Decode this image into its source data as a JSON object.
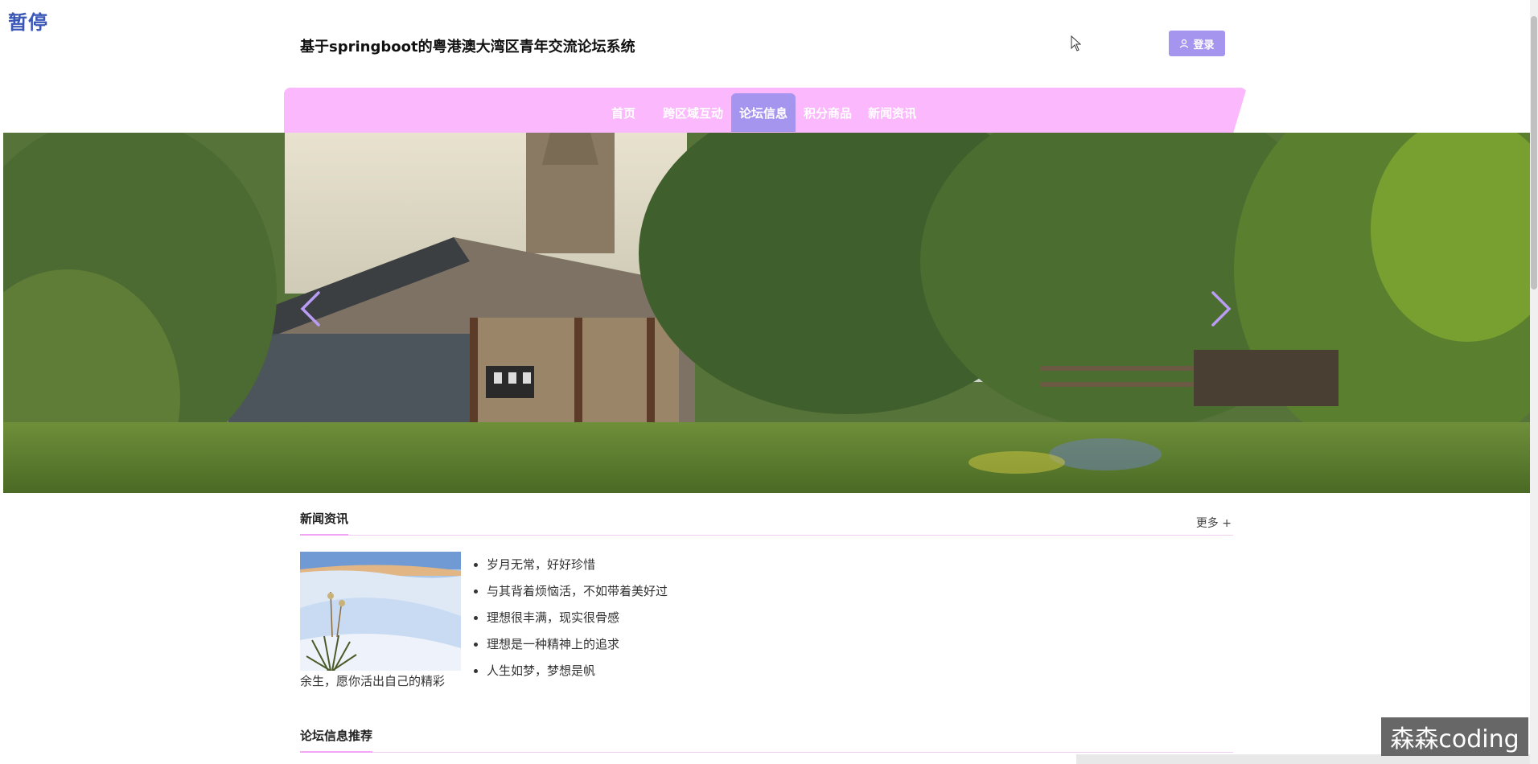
{
  "overlay": {
    "pause_label": "暂停",
    "watermark": "森森coding"
  },
  "header": {
    "title": "基于springboot的粤港澳大湾区青年交流论坛系统",
    "login_label": "登录"
  },
  "nav": {
    "items": [
      {
        "label": "首页",
        "active": false
      },
      {
        "label": "跨区域互动",
        "active": false
      },
      {
        "label": "论坛信息",
        "active": true
      },
      {
        "label": "积分商品",
        "active": false
      },
      {
        "label": "新闻资讯",
        "active": false
      }
    ]
  },
  "news": {
    "title": "新闻资讯",
    "more": "更多 +",
    "items": [
      "岁月无常，好好珍惜",
      "与其背着烦恼活，不如带着美好过",
      "理想很丰满，现实很骨感",
      "理想是一种精神上的追求",
      "人生如梦，梦想是帆"
    ],
    "featured_caption": "余生，愿你活出自己的精彩"
  },
  "forum": {
    "title": "论坛信息推荐"
  },
  "colors": {
    "accent": "#a695ee",
    "nav_bg": "#fbb8fc",
    "underline": "#f4a6f6"
  }
}
